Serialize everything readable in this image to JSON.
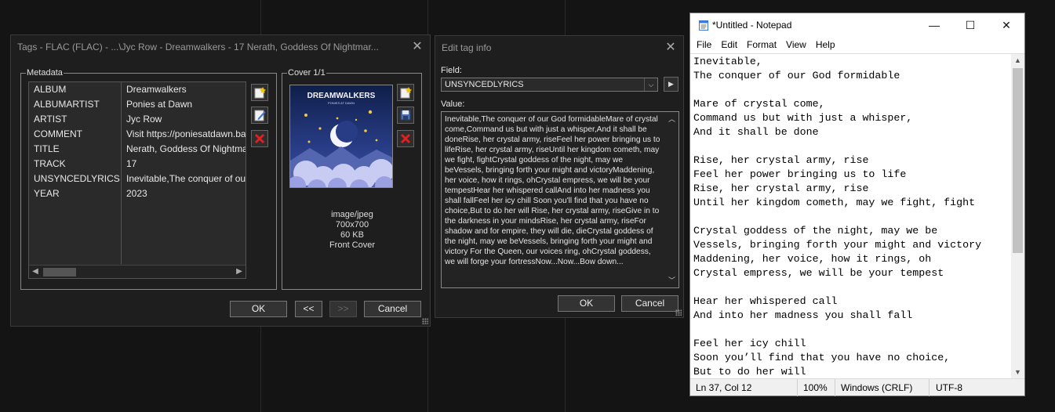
{
  "tags_dialog": {
    "title": "Tags - FLAC (FLAC) - ...\\Jyc Row - Dreamwalkers - 17 Nerath, Goddess Of Nightmar...",
    "metadata_label": "Metadata",
    "cover_label": "Cover 1/1",
    "rows": [
      {
        "key": "ALBUM",
        "value": "Dreamwalkers"
      },
      {
        "key": "ALBUMARTIST",
        "value": "Ponies at Dawn"
      },
      {
        "key": "ARTIST",
        "value": "Jyc Row"
      },
      {
        "key": "COMMENT",
        "value": "Visit https://poniesatdawn.ba"
      },
      {
        "key": "TITLE",
        "value": "Nerath, Goddess Of Nightma"
      },
      {
        "key": "TRACK",
        "value": "17"
      },
      {
        "key": "UNSYNCEDLYRICS",
        "value": "Inevitable,The conquer of ou"
      },
      {
        "key": "YEAR",
        "value": "2023"
      }
    ],
    "cover_art_title": "DREAMWALKERS",
    "cover_art_subtitle": "PONIES AT DAWN",
    "cover_info": {
      "mime": "image/jpeg",
      "dimensions": "700x700",
      "size": "60 KB",
      "type": "Front Cover"
    },
    "ok_label": "OK",
    "prev_label": "<<",
    "next_label": ">>",
    "cancel_label": "Cancel"
  },
  "edit_dialog": {
    "title": "Edit tag info",
    "field_label": "Field:",
    "field_value": "UNSYNCEDLYRICS",
    "value_label": "Value:",
    "value_text": "Inevitable,The conquer of our God formidableMare of crystal come,Command us but with just a whisper,And it shall be doneRise, her crystal army, riseFeel her power bringing us to lifeRise, her crystal army, riseUntil her kingdom cometh, may we fight, fightCrystal goddess of the night, may we beVessels, bringing forth your might and victoryMaddening, her voice, how it rings, ohCrystal empress, we will be your tempestHear her whispered callAnd into her madness you shall fallFeel her icy chill Soon you'll find that you have no choice,But to do her will Rise, her crystal army, riseGive in to the darkness in your mindsRise, her crystal army, riseFor shadow and for empire, they will die, dieCrystal goddess of the night, may we beVessels, bringing forth your might and victory For the Queen, our voices ring, ohCrystal goddess, we will forge your fortressNow...Now...Bow down...",
    "ok_label": "OK",
    "cancel_label": "Cancel"
  },
  "notepad": {
    "title": "*Untitled - Notepad",
    "menu": [
      "File",
      "Edit",
      "Format",
      "View",
      "Help"
    ],
    "text": "Inevitable,\nThe conquer of our God formidable\n\nMare of crystal come,\nCommand us but with just a whisper,\nAnd it shall be done\n\nRise, her crystal army, rise\nFeel her power bringing us to life\nRise, her crystal army, rise\nUntil her kingdom cometh, may we fight, fight\n\nCrystal goddess of the night, may we be\nVessels, bringing forth your might and victory\nMaddening, her voice, how it rings, oh\nCrystal empress, we will be your tempest\n\nHear her whispered call\nAnd into her madness you shall fall\n\nFeel her icy chill\nSoon you’ll find that you have no choice,\nBut to do her will",
    "status": {
      "position": "Ln 37, Col 12",
      "zoom": "100%",
      "line_ending": "Windows (CRLF)",
      "encoding": "UTF-8"
    }
  }
}
